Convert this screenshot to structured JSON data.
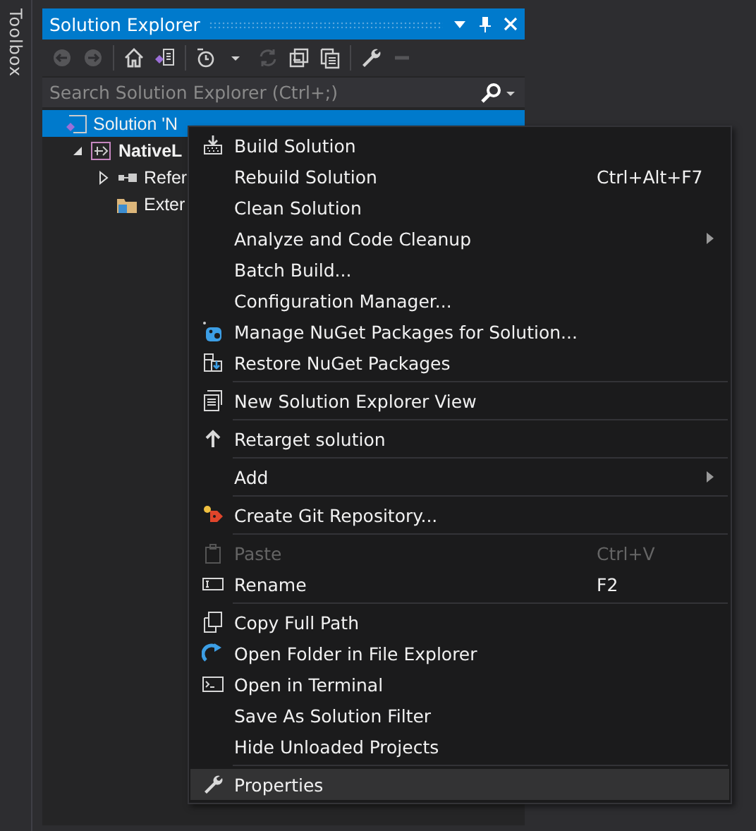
{
  "toolbox": {
    "label": "Toolbox"
  },
  "panel": {
    "title": "Solution Explorer",
    "toolbar": [
      {
        "disabled": true
      },
      {
        "disabled": true
      },
      {
        "disabled": false
      },
      {
        "disabled": false
      },
      {
        "disabled": false
      },
      {
        "disabled": true
      },
      {
        "disabled": false
      },
      {
        "disabled": false
      },
      {
        "disabled": false
      },
      {
        "disabled": true
      }
    ],
    "search": {
      "placeholder": "Search Solution Explorer (Ctrl+;)"
    },
    "tree": [
      {
        "label": "Solution 'N",
        "selected": true,
        "bold": false,
        "children": [
          {
            "label": "NativeL",
            "selected": false,
            "bold": true,
            "expanded": true,
            "children": [
              {
                "label": "Refer",
                "selected": false,
                "bold": false,
                "expanded": false
              },
              {
                "label": "Exter",
                "selected": false,
                "bold": false
              }
            ]
          }
        ]
      }
    ]
  },
  "context_menu": {
    "items": [
      {
        "kind": "item",
        "label": "Build Solution",
        "disabled": false,
        "highlighted": false
      },
      {
        "kind": "item",
        "label": "Rebuild Solution",
        "shortcut": "Ctrl+Alt+F7",
        "disabled": false,
        "highlighted": false
      },
      {
        "kind": "item",
        "label": "Clean Solution",
        "disabled": false,
        "highlighted": false
      },
      {
        "kind": "item",
        "label": "Analyze and Code Cleanup",
        "submenu": true,
        "disabled": false,
        "highlighted": false
      },
      {
        "kind": "item",
        "label": "Batch Build...",
        "disabled": false,
        "highlighted": false
      },
      {
        "kind": "item",
        "label": "Configuration Manager...",
        "disabled": false,
        "highlighted": false
      },
      {
        "kind": "item",
        "label": "Manage NuGet Packages for Solution...",
        "disabled": false,
        "highlighted": false
      },
      {
        "kind": "item",
        "label": "Restore NuGet Packages",
        "disabled": false,
        "highlighted": false
      },
      {
        "kind": "separator"
      },
      {
        "kind": "item",
        "label": "New Solution Explorer View",
        "disabled": false,
        "highlighted": false
      },
      {
        "kind": "separator"
      },
      {
        "kind": "item",
        "label": "Retarget solution",
        "disabled": false,
        "highlighted": false
      },
      {
        "kind": "separator"
      },
      {
        "kind": "item",
        "label": "Add",
        "submenu": true,
        "disabled": false,
        "highlighted": false
      },
      {
        "kind": "separator"
      },
      {
        "kind": "item",
        "label": "Create Git Repository...",
        "disabled": false,
        "highlighted": false
      },
      {
        "kind": "separator"
      },
      {
        "kind": "item",
        "label": "Paste",
        "shortcut": "Ctrl+V",
        "disabled": true,
        "highlighted": false
      },
      {
        "kind": "item",
        "label": "Rename",
        "shortcut": "F2",
        "disabled": false,
        "highlighted": false
      },
      {
        "kind": "separator"
      },
      {
        "kind": "item",
        "label": "Copy Full Path",
        "disabled": false,
        "highlighted": false
      },
      {
        "kind": "item",
        "label": "Open Folder in File Explorer",
        "disabled": false,
        "highlighted": false
      },
      {
        "kind": "item",
        "label": "Open in Terminal",
        "disabled": false,
        "highlighted": false
      },
      {
        "kind": "item",
        "label": "Save As Solution Filter",
        "disabled": false,
        "highlighted": false
      },
      {
        "kind": "item",
        "label": "Hide Unloaded Projects",
        "disabled": false,
        "highlighted": false
      },
      {
        "kind": "separator"
      },
      {
        "kind": "item",
        "label": "Properties",
        "disabled": false,
        "highlighted": true
      }
    ]
  }
}
